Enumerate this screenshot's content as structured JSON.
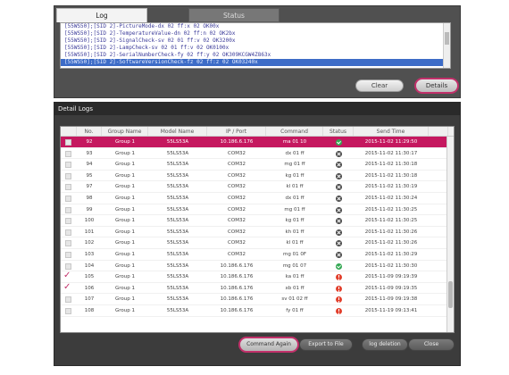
{
  "log_panel": {
    "tabs": [
      "Log",
      "Status"
    ],
    "lines": [
      "[55WS50];[SID 2]-PictureMode-dx 02 ff:x 02 OK00x",
      "[55WS50];[SID 2]-TemperatureValue-dn 02 ff:n 02 OK2bx",
      "[55WS50];[SID 2]-SignalCheck-sv 02 01 ff:v 02 OK3200x",
      "[55WS50];[SID 2]-LampCheck-sv 02 01 ff:v 02 OK0100x",
      "[55WS50];[SID 2]-SerialNumberCheck-fy 02 ff:y 02 OK309KCGW4Z863x",
      "[55WS50];[SID 2]-SoftwareVersionCheck-fz 02 ff:z 02 OK03240x"
    ],
    "selected_line_index": 5,
    "clear_label": "Clear",
    "details_label": "Details"
  },
  "detail_panel": {
    "title": "Detail Logs",
    "columns": [
      "",
      "No.",
      "Group Name",
      "Model Name",
      "IP / Port",
      "Command",
      "Status",
      "Send Time"
    ],
    "rows": [
      {
        "check": "",
        "no": "92",
        "group": "Group 1",
        "model": "55LS53A",
        "ip": "10.186.6.176",
        "cmd": "ma 01 10",
        "status": "ok",
        "time": "2015-11-02 11:29:50"
      },
      {
        "check": "",
        "no": "93",
        "group": "Group 1",
        "model": "55LS53A",
        "ip": "COM32",
        "cmd": "dx 01 ff",
        "status": "fail",
        "time": "2015-11-02 11:30:17"
      },
      {
        "check": "",
        "no": "94",
        "group": "Group 1",
        "model": "55LS53A",
        "ip": "COM32",
        "cmd": "mg 01 ff",
        "status": "fail",
        "time": "2015-11-02 11:30:18"
      },
      {
        "check": "",
        "no": "95",
        "group": "Group 1",
        "model": "55LS53A",
        "ip": "COM32",
        "cmd": "kg 01 ff",
        "status": "fail",
        "time": "2015-11-02 11:30:18"
      },
      {
        "check": "",
        "no": "97",
        "group": "Group 1",
        "model": "55LS53A",
        "ip": "COM32",
        "cmd": "kl 01 ff",
        "status": "fail",
        "time": "2015-11-02 11:30:19"
      },
      {
        "check": "",
        "no": "98",
        "group": "Group 1",
        "model": "55LS53A",
        "ip": "COM32",
        "cmd": "dx 01 ff",
        "status": "fail",
        "time": "2015-11-02 11:30:24"
      },
      {
        "check": "",
        "no": "99",
        "group": "Group 1",
        "model": "55LS53A",
        "ip": "COM32",
        "cmd": "mg 01 ff",
        "status": "fail",
        "time": "2015-11-02 11:30:25"
      },
      {
        "check": "",
        "no": "100",
        "group": "Group 1",
        "model": "55LS53A",
        "ip": "COM32",
        "cmd": "kg 01 ff",
        "status": "fail",
        "time": "2015-11-02 11:30:25"
      },
      {
        "check": "",
        "no": "101",
        "group": "Group 1",
        "model": "55LS53A",
        "ip": "COM32",
        "cmd": "kh 01 ff",
        "status": "fail",
        "time": "2015-11-02 11:30:26"
      },
      {
        "check": "",
        "no": "102",
        "group": "Group 1",
        "model": "55LS53A",
        "ip": "COM32",
        "cmd": "kl 01 ff",
        "status": "fail",
        "time": "2015-11-02 11:30:26"
      },
      {
        "check": "",
        "no": "103",
        "group": "Group 1",
        "model": "55LS53A",
        "ip": "COM32",
        "cmd": "mg 01 0F",
        "status": "fail",
        "time": "2015-11-02 11:30:29"
      },
      {
        "check": "",
        "no": "104",
        "group": "Group 1",
        "model": "55LS53A",
        "ip": "10.186.6.176",
        "cmd": "mg 01 07",
        "status": "ok",
        "time": "2015-11-02 11:30:30"
      },
      {
        "check": "✓",
        "no": "105",
        "group": "Group 1",
        "model": "55LS53A",
        "ip": "10.186.6.176",
        "cmd": "ka 01 ff",
        "status": "err",
        "time": "2015-11-09 09:19:39"
      },
      {
        "check": "✓",
        "no": "106",
        "group": "Group 1",
        "model": "55LS53A",
        "ip": "10.186.6.176",
        "cmd": "xb 01 ff",
        "status": "err",
        "time": "2015-11-09 09:19:35"
      },
      {
        "check": "",
        "no": "107",
        "group": "Group 1",
        "model": "55LS53A",
        "ip": "10.186.6.176",
        "cmd": "sv 01 02 ff",
        "status": "err",
        "time": "2015-11-09 09:19:38"
      },
      {
        "check": "",
        "no": "108",
        "group": "Group 1",
        "model": "55LS53A",
        "ip": "10.186.6.176",
        "cmd": "fy 01 ff",
        "status": "err",
        "time": "2015-11-19 09:13:41"
      }
    ],
    "selected_row_index": 0,
    "buttons": {
      "command_again": "Command Again",
      "export": "Export to File",
      "log_delete": "log deletion",
      "close": "Close"
    }
  },
  "colors": {
    "accent": "#c2306a",
    "selection": "#c5185f",
    "status_ok": "#34a853",
    "status_fail": "#444444",
    "status_err": "#e2402d"
  }
}
